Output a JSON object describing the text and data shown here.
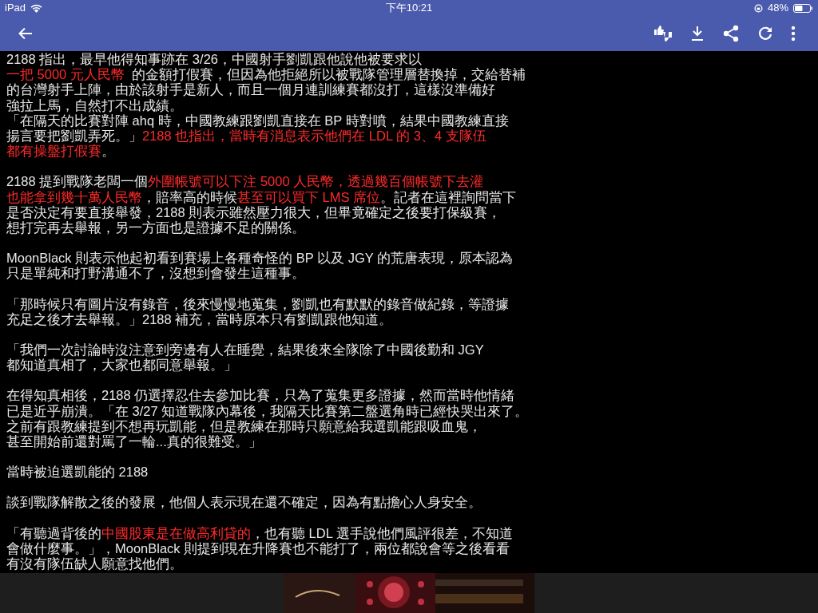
{
  "status_bar": {
    "device": "iPad",
    "time": "下午10:21",
    "battery": "48%"
  },
  "paragraphs": [
    [
      [
        {
          "text": "2188 指出，最早他得知事跡在 3/26，中國射手劉凱跟他說他被要求以"
        }
      ],
      [
        {
          "text": "一把 5000 元人民幣 ",
          "red": true
        },
        {
          "text": " 的金額打假賽，但因為他拒絕所以被戰隊管理層替換掉，交給替補"
        }
      ],
      [
        {
          "text": "的台灣射手上陣，由於該射手是新人，而且一個月連訓練賽都沒打，這樣沒準備好"
        }
      ],
      [
        {
          "text": "強拉上馬，自然打不出成績。"
        }
      ],
      [
        {
          "text": "「在隔天的比賽對陣 ahq 時，中國教練跟劉凱直接在 BP 時對噴，結果中國教練直接"
        }
      ],
      [
        {
          "text": "揚言要把劉凱弄死。」"
        },
        {
          "text": "2188 也指出，當時有消息表示他們在 LDL 的 3、4 支隊伍",
          "red": true
        }
      ],
      [
        {
          "text": "都有操盤打假賽",
          "red": true
        },
        {
          "text": "。"
        }
      ]
    ],
    [
      [
        {
          "text": "2188 提到戰隊老闆一個"
        },
        {
          "text": "外圍帳號可以下注 5000 人民幣，透過幾百個帳號下去灌",
          "red": true
        }
      ],
      [
        {
          "text": "也能拿到幾十萬人民幣",
          "red": true
        },
        {
          "text": "，賠率高的時候"
        },
        {
          "text": "甚至可以買下 LMS 席位",
          "red": true
        },
        {
          "text": "。記者在這裡詢問當下"
        }
      ],
      [
        {
          "text": "是否決定有要直接舉發，2188 則表示雖然壓力很大，但畢竟確定之後要打保級賽，"
        }
      ],
      [
        {
          "text": "想打完再去舉報，另一方面也是證據不足的關係。"
        }
      ]
    ],
    [
      [
        {
          "text": "MoonBlack 則表示他起初看到賽場上各種奇怪的 BP 以及 JGY 的荒唐表現，原本認為"
        }
      ],
      [
        {
          "text": "只是單純和打野溝通不了，沒想到會發生這種事。"
        }
      ]
    ],
    [
      [
        {
          "text": "「那時候只有圖片沒有錄音，後來慢慢地蒐集，劉凱也有默默的錄音做紀錄，等證據"
        }
      ],
      [
        {
          "text": "充足之後才去舉報。」2188 補充，當時原本只有劉凱跟他知道。"
        }
      ]
    ],
    [
      [
        {
          "text": "「我們一次討論時沒注意到旁邊有人在睡覺，結果後來全隊除了中國後勤和 JGY"
        }
      ],
      [
        {
          "text": "都知道真相了，大家也都同意舉報。」"
        }
      ]
    ],
    [
      [
        {
          "text": "在得知真相後，2188 仍選擇忍住去參加比賽，只為了蒐集更多證據，然而當時他情緒"
        }
      ],
      [
        {
          "text": "已是近乎崩潰。「在 3/27 知道戰隊內幕後，我隔天比賽第二盤選角時已經快哭出來了。"
        }
      ],
      [
        {
          "text": "之前有跟教練提到不想再玩凱能，但是教練在那時只願意給我選凱能跟吸血鬼，"
        }
      ],
      [
        {
          "text": "甚至開始前還對罵了一輪...真的很難受。」"
        }
      ]
    ],
    [
      [
        {
          "text": "當時被迫選凱能的 2188"
        }
      ]
    ],
    [
      [
        {
          "text": "談到戰隊解散之後的發展，他個人表示現在還不確定，因為有點擔心人身安全。"
        }
      ]
    ],
    [
      [
        {
          "text": "「有聽過背後的"
        },
        {
          "text": "中國股東是在做高利貸的",
          "red": true
        },
        {
          "text": "，也有聽 LDL 選手說他們風評很差，不知道"
        }
      ],
      [
        {
          "text": "會做什麼事。」，MoonBlack 則提到現在升降賽也不能打了，兩位都說會等之後看看"
        }
      ],
      [
        {
          "text": "有沒有隊伍缺人願意找他們。"
        }
      ]
    ]
  ],
  "ad_banner": {
    "kind": "picture"
  }
}
